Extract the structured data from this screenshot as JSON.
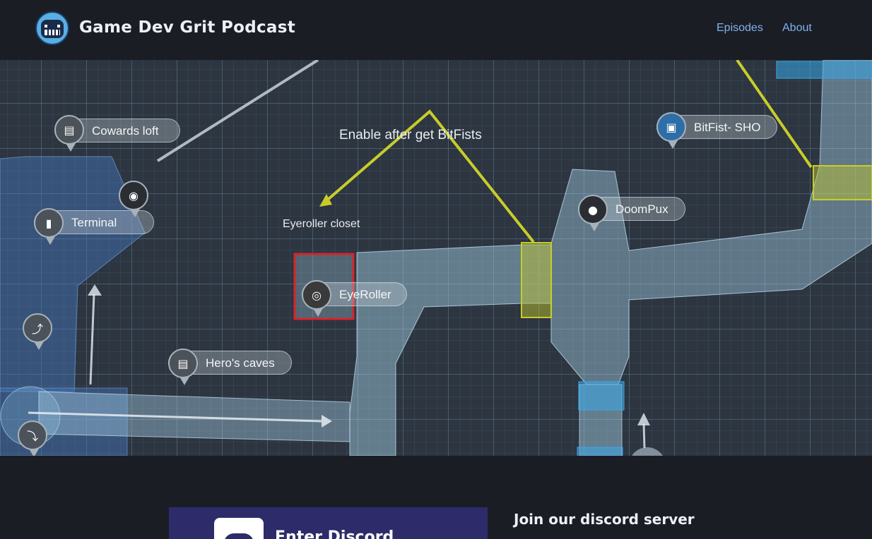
{
  "header": {
    "site_title": "Game Dev Grit Podcast",
    "logo_icon": "robot-face-logo-icon",
    "nav": [
      {
        "label": "Episodes"
      },
      {
        "label": "About"
      }
    ]
  },
  "hero_map": {
    "labels": {
      "cowards_loft": "Cowards loft",
      "terminal": "Terminal",
      "eyeroller": "EyeRoller",
      "heros_caves": "Hero's caves",
      "doompux": "DoomPux",
      "bitfist": "BitFist- SHO"
    },
    "annotations": {
      "enable_after": "Enable after get BitFists",
      "eyeroller_closet": "Eyeroller closet"
    }
  },
  "discord": {
    "heading": "Join our discord server",
    "banner_text": "Enter Discord"
  },
  "colors": {
    "page_bg": "#1a1d24",
    "nav_link": "#7fb2ee",
    "corridor": "#a9d4ec",
    "trigger_yellow": "#c8cc2a",
    "door_blue": "#3aa8e8",
    "highlight_red": "#d8232a"
  }
}
